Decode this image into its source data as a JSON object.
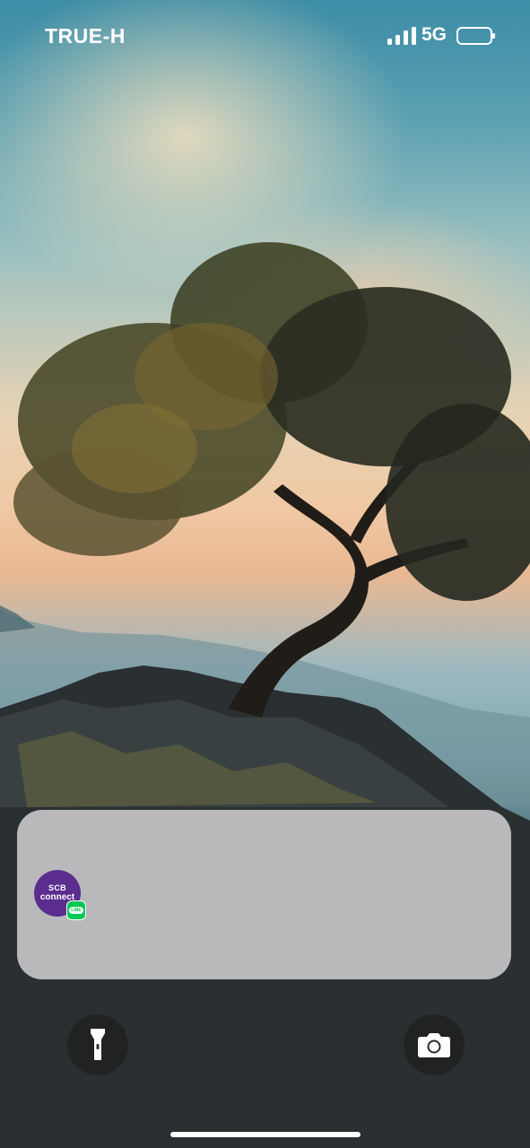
{
  "status_bar": {
    "carrier": "TRUE-H",
    "network": "5G",
    "signal_icon": "signal-bars-icon",
    "battery_icon": "battery-icon"
  },
  "notification": {
    "app_icon": {
      "line1": "SCB",
      "line2": "connect",
      "name": "scb-connect-app-icon"
    },
    "badge_icon": "line-app-badge-icon",
    "badge_text": "LINE"
  },
  "controls": {
    "flashlight_icon": "flashlight-icon",
    "camera_icon": "camera-icon"
  },
  "colors": {
    "scb_purple": "#5b2d8e",
    "line_green": "#06c755"
  }
}
